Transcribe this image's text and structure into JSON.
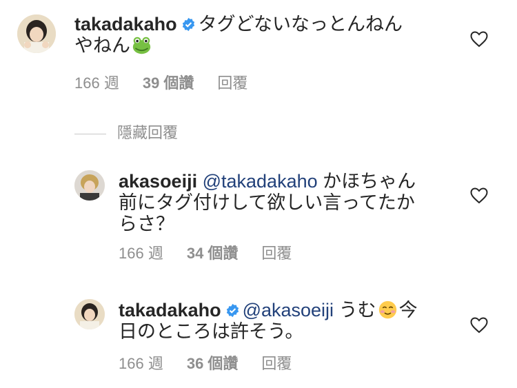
{
  "comments": [
    {
      "username": "takadakaho",
      "mention": "",
      "text_line1": "タグどないなっとんねん",
      "text_line2": "やねん",
      "emoji": "frog-emoji",
      "time": "166 週",
      "likes": "39 個讚",
      "reply": "回覆",
      "verified": true
    },
    {
      "username": "akasoeiji",
      "mention": "@takadakaho",
      "text_line1": "かほちゃん",
      "text_line2": "前にタグ付けして欲しい言ってたか",
      "text_line3": "らさ？",
      "time": "166 週",
      "likes": "34 個讚",
      "reply": "回覆",
      "verified": false
    },
    {
      "username": "takadakaho",
      "mention": "@akasoeiji",
      "text_a": "うむ",
      "emoji": "smiling-face-emoji",
      "text_b": "今",
      "text_line2": "日のところは許そう。",
      "time": "166 週",
      "likes": "36 個讚",
      "reply": "回覆",
      "verified": true
    }
  ],
  "hide_replies_label": "隱藏回覆",
  "colors": {
    "text": "#262626",
    "secondary": "#8e8e8e",
    "mention": "#22417a",
    "verified": "#3897f0"
  }
}
